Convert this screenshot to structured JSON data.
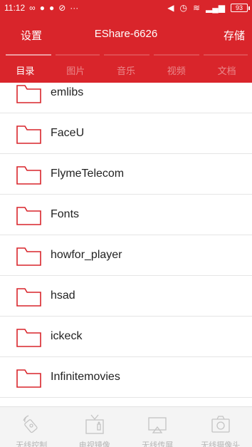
{
  "status_bar": {
    "time": "11:12",
    "battery": "93"
  },
  "header": {
    "settings_label": "设置",
    "device_name": "EShare-6626",
    "storage_label": "存储"
  },
  "tabs": [
    {
      "label": "目录",
      "active": true
    },
    {
      "label": "图片",
      "active": false
    },
    {
      "label": "音乐",
      "active": false
    },
    {
      "label": "视频",
      "active": false
    },
    {
      "label": "文档",
      "active": false
    }
  ],
  "files": [
    {
      "name": "emlibs"
    },
    {
      "name": "FaceU"
    },
    {
      "name": "FlymeTelecom"
    },
    {
      "name": "Fonts"
    },
    {
      "name": "howfor_player"
    },
    {
      "name": "hsad"
    },
    {
      "name": "ickeck"
    },
    {
      "name": "Infinitemovies"
    }
  ],
  "bottom_nav": [
    {
      "label": "无线控制",
      "icon": "remote-control-icon"
    },
    {
      "label": "电视镜像",
      "icon": "tv-mirror-icon"
    },
    {
      "label": "无线传屏",
      "icon": "screen-cast-icon"
    },
    {
      "label": "无线摄像头",
      "icon": "camera-icon"
    }
  ],
  "colors": {
    "accent": "#d9252b",
    "folder_outline": "#d9252b",
    "nav_inactive": "#b5b5b5"
  }
}
